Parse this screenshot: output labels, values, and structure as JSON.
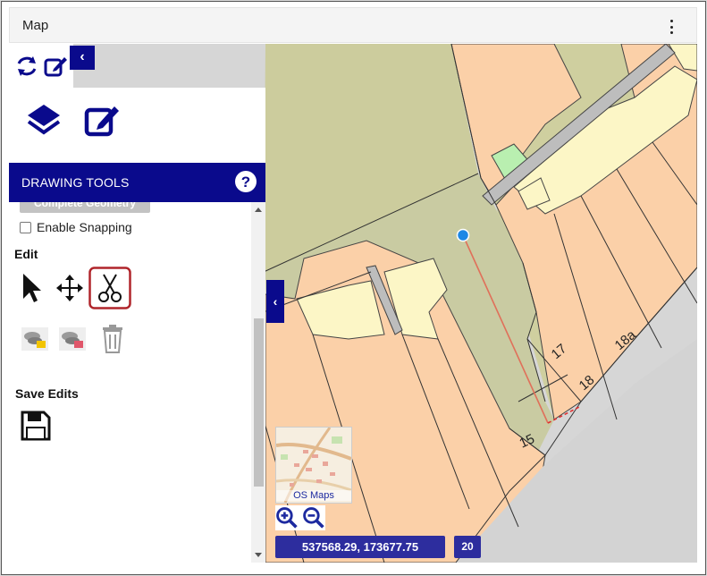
{
  "window": {
    "title": "Map"
  },
  "panel": {
    "header": "DRAWING TOOLS",
    "help_glyph": "?",
    "complete_geometry": "Complete Geometry",
    "enable_snapping": "Enable Snapping",
    "edit_label": "Edit",
    "save_label": "Save Edits"
  },
  "map": {
    "plot_labels": [
      "17",
      "18",
      "18a",
      "15"
    ],
    "thumbnail_label": "OS Maps",
    "coordinates": "537568.29, 173677.75",
    "zoom_level": "20"
  },
  "icons": {
    "top": [
      "refresh-icon",
      "edit-icon"
    ],
    "panel": [
      "layers-icon",
      "edit-icon"
    ],
    "edit_tools": [
      "select-arrow-icon",
      "move-icon",
      "scissors-icon"
    ],
    "edit_tools_row2": [
      "add-feature-icon",
      "remove-feature-icon",
      "trash-icon"
    ],
    "save": "save-icon"
  },
  "colors": {
    "primary": "#0a0a8c",
    "coord_bg": "#2d2d9e",
    "selected_tool_border": "#b0252b",
    "vertex": "#1e88e5",
    "sketch_line": "#e0705a"
  }
}
